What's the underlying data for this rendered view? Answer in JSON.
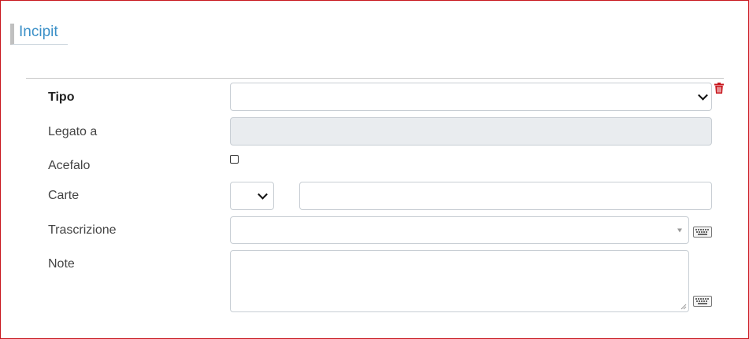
{
  "section": {
    "title": "Incipit"
  },
  "fields": {
    "tipo": {
      "label": "Tipo",
      "value": ""
    },
    "legato_a": {
      "label": "Legato a",
      "value": ""
    },
    "acefalo": {
      "label": "Acefalo",
      "checked": false
    },
    "carte": {
      "label": "Carte",
      "select_value": "",
      "text_value": ""
    },
    "trascrizione": {
      "label": "Trascrizione",
      "value": ""
    },
    "note": {
      "label": "Note",
      "value": ""
    }
  },
  "icons": {
    "delete": "trash-icon",
    "keyboard": "keyboard-icon"
  },
  "colors": {
    "accent": "#3a8fc7",
    "danger": "#c8171e",
    "disabled_bg": "#e9ecef"
  }
}
